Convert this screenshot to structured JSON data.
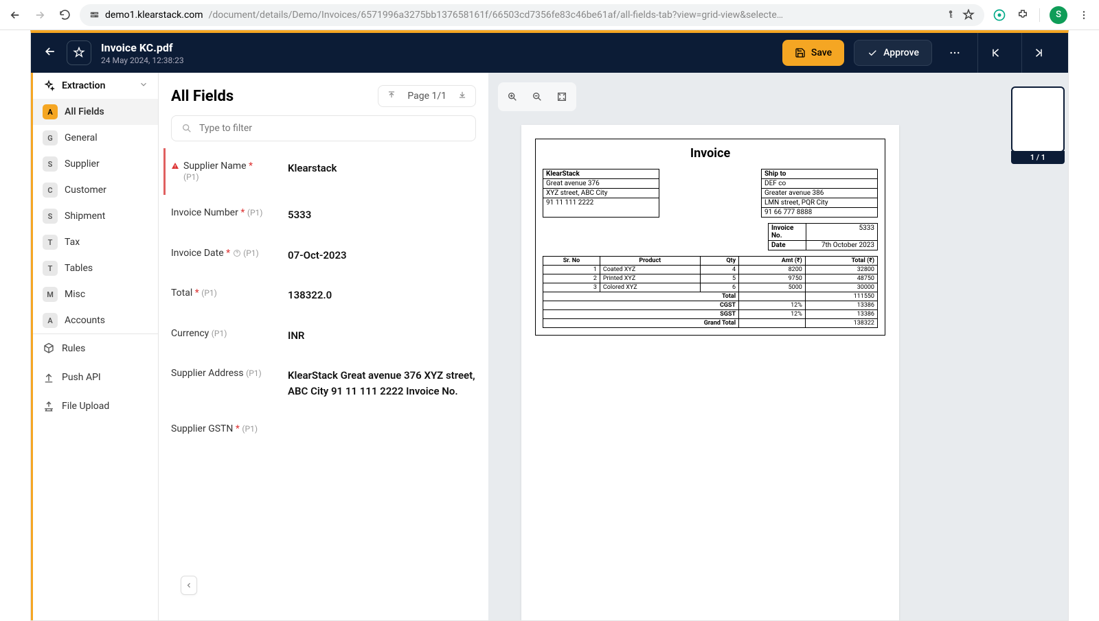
{
  "browser": {
    "url_domain": "demo1.klearstack.com",
    "url_path": "/document/details/Demo/Invoices/6571996a3275bb137658161f/66503cd7356fe83c46be61af/all-fields-tab?view=grid-view&selecte…",
    "avatar_initial": "S"
  },
  "header": {
    "doc_title": "Invoice KC.pdf",
    "doc_date": "24 May 2024, 12:38:23",
    "save_label": "Save",
    "approve_label": "Approve"
  },
  "sidebar": {
    "section_label": "Extraction",
    "items": [
      {
        "badge": "A",
        "label": "All Fields",
        "active": true
      },
      {
        "badge": "G",
        "label": "General"
      },
      {
        "badge": "S",
        "label": "Supplier"
      },
      {
        "badge": "C",
        "label": "Customer"
      },
      {
        "badge": "S",
        "label": "Shipment"
      },
      {
        "badge": "T",
        "label": "Tax"
      },
      {
        "badge": "T",
        "label": "Tables"
      },
      {
        "badge": "M",
        "label": "Misc"
      },
      {
        "badge": "A",
        "label": "Accounts"
      }
    ],
    "rules_label": "Rules",
    "pushapi_label": "Push API",
    "upload_label": "File Upload"
  },
  "center": {
    "title": "All Fields",
    "page_label": "Page 1/1",
    "search_placeholder": "Type to filter",
    "fields": [
      {
        "label": "Supplier Name",
        "required": true,
        "pn": "(P1)",
        "value": "Klearstack",
        "alert": true
      },
      {
        "label": "Invoice Number",
        "required": true,
        "pn": "(P1)",
        "value": "5333"
      },
      {
        "label": "Invoice Date",
        "required": true,
        "pn": "(P1)",
        "value": "07-Oct-2023",
        "help": true
      },
      {
        "label": "Total",
        "required": true,
        "pn": "(P1)",
        "value": "138322.0"
      },
      {
        "label": "Currency",
        "required": false,
        "pn": "(P1)",
        "value": "INR"
      },
      {
        "label": "Supplier Address",
        "required": false,
        "pn": "(P1)",
        "value": "KlearStack Great avenue 376 XYZ street, ABC City 91 11 111 2222 Invoice No."
      },
      {
        "label": "Supplier GSTN",
        "required": true,
        "pn": "(P1)",
        "value": ""
      }
    ]
  },
  "invoice": {
    "title": "Invoice",
    "from": [
      "KlearStack",
      "Great avenue 376",
      "XYZ street, ABC City",
      "91 11 111 2222"
    ],
    "shipto_head": "Ship to",
    "shipto": [
      "DEF co",
      "Greater avenue 386",
      "LMN street, PQR City",
      "91 66 777 8888"
    ],
    "meta": [
      {
        "k": "Invoice No.",
        "v": "5333"
      },
      {
        "k": "Date",
        "v": "7th October 2023"
      }
    ],
    "cols": [
      "Sr. No",
      "Product",
      "Qty",
      "Amt (₹)",
      "Total (₹)"
    ],
    "items": [
      {
        "no": "1",
        "prod": "Coated XYZ",
        "qty": "4",
        "amt": "8200",
        "tot": "32800"
      },
      {
        "no": "2",
        "prod": "Printed XYZ",
        "qty": "5",
        "amt": "9750",
        "tot": "48750"
      },
      {
        "no": "3",
        "prod": "Colored XYZ",
        "qty": "6",
        "amt": "5000",
        "tot": "30000"
      }
    ],
    "totals": [
      {
        "label": "Total",
        "pct": "",
        "val": "111550"
      },
      {
        "label": "CGST",
        "pct": "12%",
        "val": "13386"
      },
      {
        "label": "SGST",
        "pct": "12%",
        "val": "13386"
      },
      {
        "label": "Grand Total",
        "pct": "",
        "val": "138322"
      }
    ]
  },
  "thumb": {
    "label": "1 / 1"
  }
}
